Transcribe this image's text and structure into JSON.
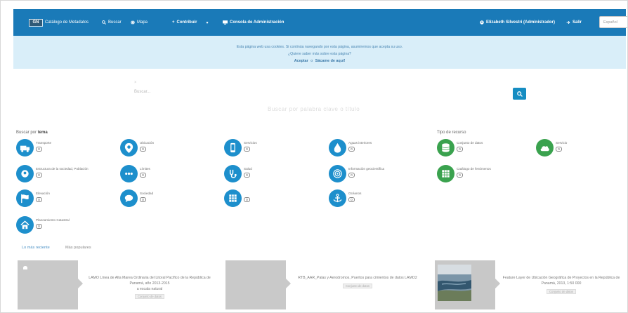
{
  "nav": {
    "logo_badge": "GN",
    "brand": "Catálogo de Metadatos",
    "search": "Buscar",
    "map": "Mapa",
    "contribute": "Contribuir",
    "contribute_caret": "▾",
    "admin": "Consola de Administración",
    "user": "Elizabeth Silvestri (Administrador)",
    "logout": "Salir",
    "language": "Español"
  },
  "banner": {
    "line1": "Esta página web usa cookies. Si continúa navegando por esta página, asumiremos que acepta su uso.",
    "line2": "¿Quiere saber más sobre esta página?",
    "accept": "Aceptar",
    "separator": "o",
    "leave": "Sácame de aquí!"
  },
  "search": {
    "placeholder": "Buscar...",
    "hint": "Buscar por palabra clave o título"
  },
  "sections": {
    "themes_prefix": "Buscar por",
    "themes_bold": "tema",
    "resource_type": "Tipo de recurso"
  },
  "themes": [
    {
      "label": "Transporte",
      "count": "0",
      "icon": "truck-icon",
      "color": "#1d8fcc"
    },
    {
      "label": "Ubicación",
      "count": "0",
      "icon": "map-pin-icon",
      "color": "#1d8fcc"
    },
    {
      "label": "Servicios",
      "count": "0",
      "icon": "mobile-icon",
      "color": "#1d8fcc"
    },
    {
      "label": "Aguas interiores",
      "count": "0",
      "icon": "water-drop-icon",
      "color": "#1d8fcc"
    },
    {
      "label": "Conjunto de datos",
      "count": "0",
      "icon": "database-icon",
      "color": "#3aa24e"
    },
    {
      "label": "Servicio",
      "count": "0",
      "icon": "cloud-icon",
      "color": "#3aa24e"
    },
    {
      "label": "Estructura de la sociedad, Población",
      "count": "0",
      "icon": "people-icon",
      "color": "#1d8fcc"
    },
    {
      "label": "Límites",
      "count": "0",
      "icon": "dots-icon",
      "color": "#1d8fcc"
    },
    {
      "label": "Salud",
      "count": "0",
      "icon": "stethoscope-icon",
      "color": "#1d8fcc"
    },
    {
      "label": "Información geocientífica",
      "count": "0",
      "icon": "target-icon",
      "color": "#1d8fcc"
    },
    {
      "label": "Catálogo de fenómenos",
      "count": "0",
      "icon": "grid-icon",
      "color": "#3aa24e"
    },
    {
      "label": "Elevación",
      "count": "0",
      "icon": "flag-icon",
      "color": "#1d8fcc"
    },
    {
      "label": "Sociedad",
      "count": "0",
      "icon": "chat-icon",
      "color": "#1d8fcc"
    },
    {
      "label": "",
      "count": "0",
      "icon": "table-icon",
      "color": "#1d8fcc"
    },
    {
      "label": "Océanos",
      "count": "0",
      "icon": "anchor-icon",
      "color": "#1d8fcc"
    },
    {
      "label": "Planeamiento Catastral",
      "count": "0",
      "icon": "home-icon",
      "color": "#1d8fcc"
    }
  ],
  "tabs": {
    "latest": "Lo más reciente",
    "popular": "Más populares"
  },
  "cards": [
    {
      "title": "LAMO Línea de Alta Marea Ordinaria del Litoral Pacífico de la República de Panamá, año 2013-2015",
      "subtitle": "a escala natural",
      "badge": "Conjunto de datos"
    },
    {
      "title": "RTB_AAR_Palas y Aerodromos, Puertos para cimientos de datos LAMO2",
      "subtitle": "",
      "badge": "Conjunto de datos"
    },
    {
      "title": "Feature Layer de Ubicación Geográfica de Proyectos en la República de Panamá, 2013, 1:50",
      "subtitle": "000",
      "badge": "Conjunto de datos"
    }
  ]
}
